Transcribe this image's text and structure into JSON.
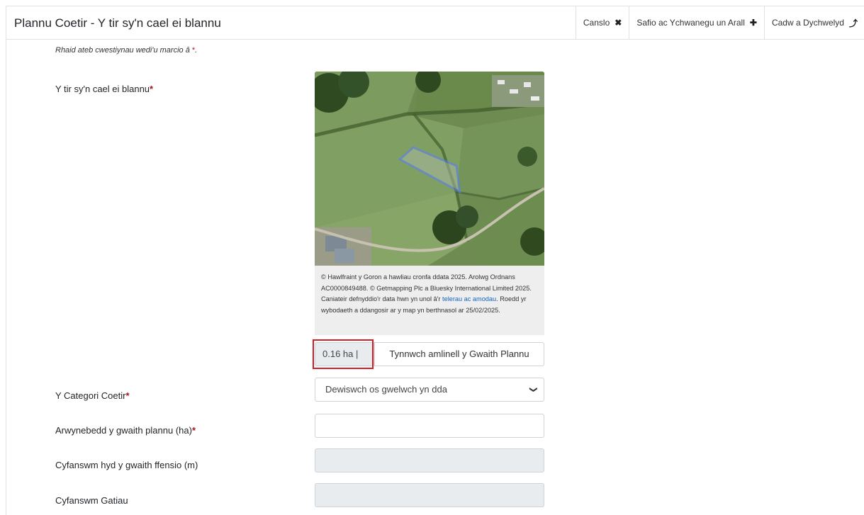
{
  "header": {
    "title": "Plannu Coetir - Y tir sy'n cael ei blannu",
    "actions": [
      {
        "label": "Canslo",
        "icon": "close-icon"
      },
      {
        "label": "Safio ac Ychwanegu un Arall",
        "icon": "plus-icon"
      },
      {
        "label": "Cadw a Dychwelyd",
        "icon": "return-icon"
      }
    ]
  },
  "form": {
    "required_note": "Rhaid ateb cwestiynau wedi'u marcio â",
    "required_marker": "*",
    "required_note_end": ".",
    "land_label": "Y tir sy'n cael ei blannu",
    "attribution_prefix": "© Hawlfraint y Goron a hawliau cronfa ddata 2025. Arolwg Ordnans AC0000849488. © Getmapping Plc a Bluesky International Limited 2025. Caniateir defnyddio'r data hwn yn unol â'r ",
    "attribution_link": "telerau ac amodau",
    "attribution_suffix": ". Roedd yr wybodaeth a ddangosir ar y map yn berthnasol ar 25/02/2025.",
    "area_value": "0.16 ha |",
    "draw_button": "Tynnwch amlinell y Gwaith Plannu",
    "category_label": "Y Categori Coetir",
    "category_value": "Dewiswch os gwelwch yn dda",
    "surface_label": "Arwynebedd y gwaith plannu (ha)",
    "surface_value": "",
    "fence_label": "Cyfanswm hyd y gwaith ffensio (m)",
    "fence_value": "",
    "gates_label": "Cyfanswm Gatiau",
    "gates_value": ""
  },
  "colors": {
    "required": "#a4161a",
    "highlight": "#d21f26",
    "parcel_outline": "#5b7cff",
    "link": "#1565c0"
  }
}
